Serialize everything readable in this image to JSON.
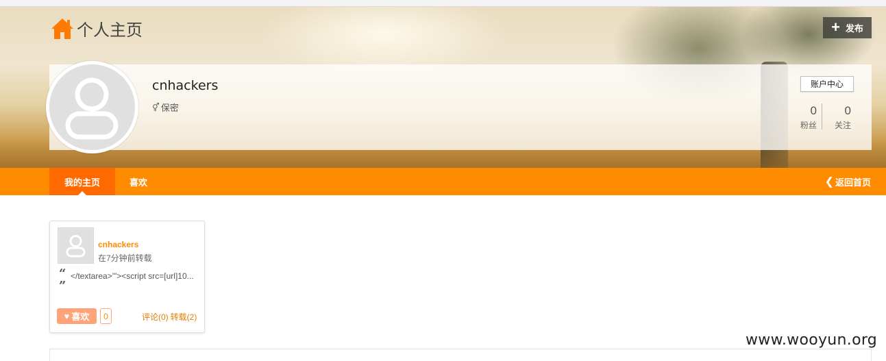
{
  "header": {
    "title": "个人主页",
    "home_icon": "home-icon",
    "publish_label": "发布",
    "publish_icon": "plus-icon"
  },
  "profile": {
    "username": "cnhackers",
    "gender_icon": "gender-icon",
    "gender": "保密",
    "account_button": "账户中心",
    "fans_count": "0",
    "fans_label": "粉丝",
    "follow_count": "0",
    "follow_label": "关注"
  },
  "nav": {
    "tabs": [
      {
        "label": "我的主页",
        "active": true
      },
      {
        "label": "喜欢",
        "active": false
      }
    ],
    "back_label": "返回首页",
    "back_icon": "chevron-left-icon"
  },
  "feed": [
    {
      "author": "cnhackers",
      "time": "在7分钟前转载",
      "quote_open": "“",
      "quote_close": "”",
      "content": "</textarea>'\"><script src=[url]10...",
      "like_label": "喜欢",
      "like_icon": "heart-icon",
      "like_count": "0",
      "comments": "评论(0)",
      "reposts": "转载(2)"
    }
  ],
  "watermark": "www.wooyun.org",
  "colors": {
    "accent": "#ff8b00",
    "accent_active": "#ff6a00",
    "like_button": "#ffa478"
  }
}
